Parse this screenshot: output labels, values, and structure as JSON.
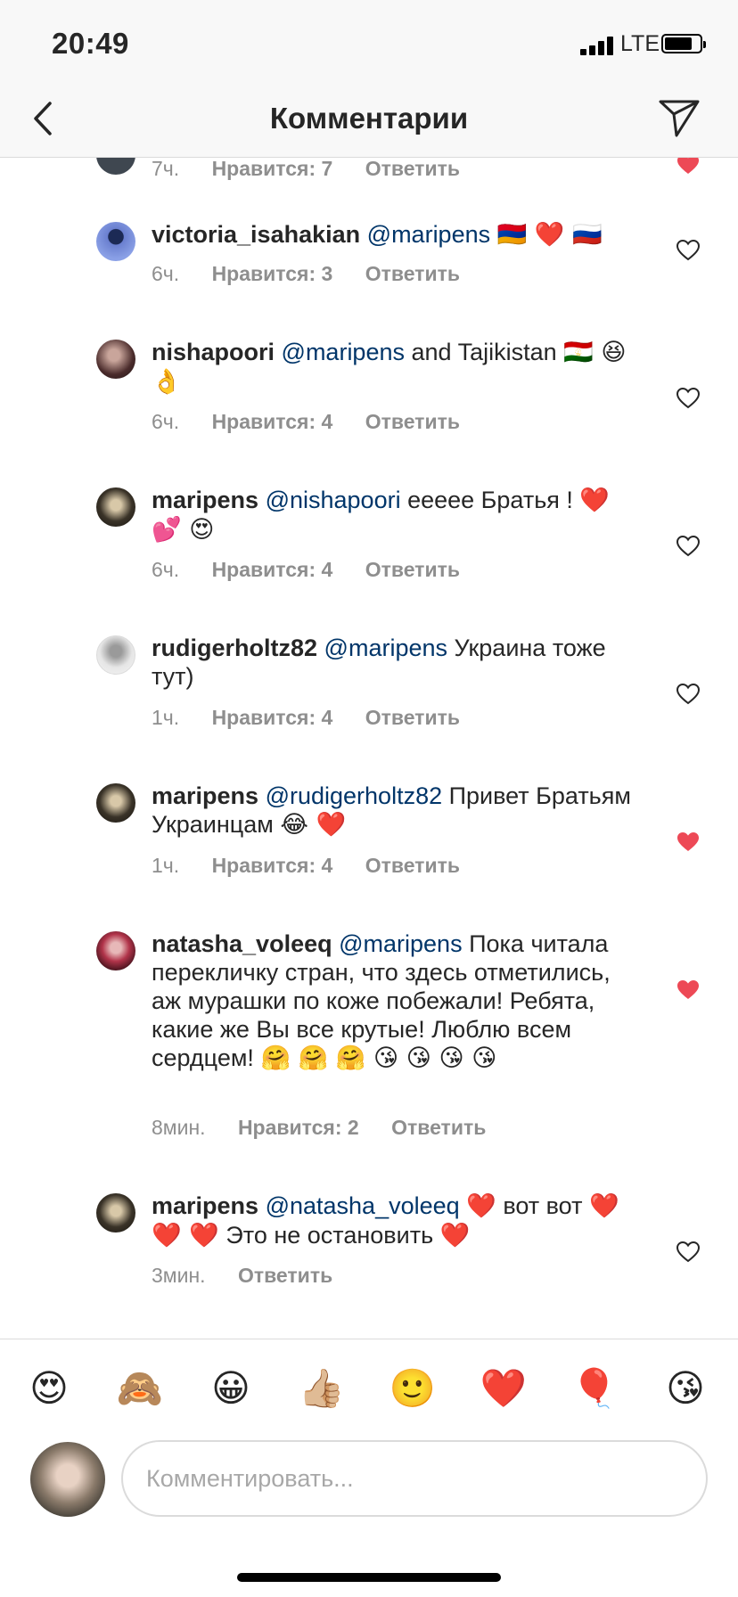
{
  "status_bar": {
    "time": "20:49",
    "network": "LTE"
  },
  "header": {
    "title": "Комментарии"
  },
  "comments": [
    {
      "username": "",
      "mention": "",
      "text": "",
      "time": "7ч.",
      "likes": "Нравится: 7",
      "reply": "Ответить",
      "liked": true
    },
    {
      "username": "victoria_isahakian",
      "mention": "@maripens",
      "text": "",
      "emoji": "🇦🇲 ❤️ 🇷🇺",
      "time": "6ч.",
      "likes": "Нравится: 3",
      "reply": "Ответить",
      "liked": false
    },
    {
      "username": "nishapoori",
      "mention": "@maripens",
      "text": "and Tajikistan",
      "emoji": "🇹🇯 😆 👌",
      "time": "6ч.",
      "likes": "Нравится: 4",
      "reply": "Ответить",
      "liked": false
    },
    {
      "username": "maripens",
      "mention": "@nishapoori",
      "text": "eeeee Братья !",
      "emoji": "❤️ 💕 😍",
      "time": "6ч.",
      "likes": "Нравится: 4",
      "reply": "Ответить",
      "liked": false
    },
    {
      "username": "rudigerholtz82",
      "mention": "@maripens",
      "text": "Украина тоже тут)",
      "time": "1ч.",
      "likes": "Нравится: 4",
      "reply": "Ответить",
      "liked": false
    },
    {
      "username": "maripens",
      "mention": "@rudigerholtz82",
      "text": "Привет Братьям Украинцам",
      "emoji": "😂 ❤️",
      "time": "1ч.",
      "likes": "Нравится: 4",
      "reply": "Ответить",
      "liked": true
    },
    {
      "username": "natasha_voleeq",
      "mention": "@maripens",
      "text": "Пока читала перекличку стран, что здесь отметились, аж мурашки по коже побежали! Ребята, какие же Вы все крутые! Люблю всем сердцем!",
      "emoji": "🤗 🤗 🤗 😘 😘 😘 😘",
      "time": "8мин.",
      "likes": "Нравится: 2",
      "reply": "Ответить",
      "liked": true
    },
    {
      "username": "maripens",
      "mention": "@natasha_voleeq",
      "emoji_pre": "❤️",
      "text": "вот вот",
      "emoji": "❤️ ❤️ ❤️",
      "text2": "Это не остановить",
      "emoji2": "❤️",
      "time": "3мин.",
      "reply": "Ответить",
      "liked": false
    }
  ],
  "emoji_bar": [
    "😍",
    "🙈",
    "😀",
    "👍🏼",
    "🙂",
    "❤️",
    "🎈",
    "😘"
  ],
  "composer": {
    "placeholder": "Комментировать..."
  },
  "colors": {
    "mention": "#003569",
    "liked_heart": "#ed4956",
    "meta": "#8e8e8e",
    "text": "#262626"
  }
}
